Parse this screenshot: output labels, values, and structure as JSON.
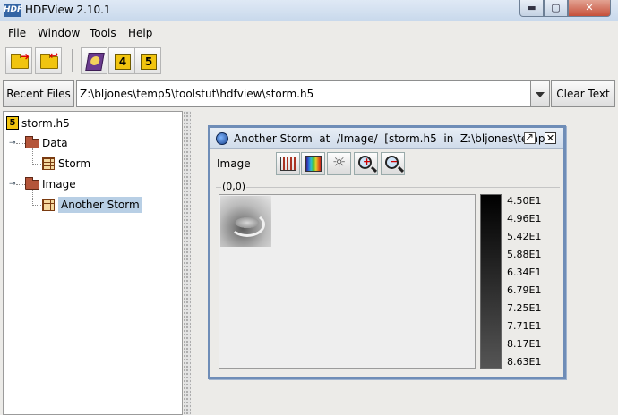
{
  "window": {
    "title": "HDFView 2.10.1",
    "app_icon_text": "HDF",
    "min_glyph": "▬",
    "max_glyph": "▢",
    "close_glyph": "✕"
  },
  "menu": [
    {
      "accel": "F",
      "rest": "ile"
    },
    {
      "accel": "W",
      "rest": "indow"
    },
    {
      "accel": "T",
      "rest": "ools"
    },
    {
      "accel": "H",
      "rest": "elp"
    }
  ],
  "toolbar": {
    "buttons": [
      "open-file-icon",
      "close-file-icon",
      "user-guide-icon",
      "hdf4-library-icon",
      "hdf5-library-icon"
    ],
    "hdf4_label": "4",
    "hdf5_label": "5"
  },
  "pathbar": {
    "recent_label": "Recent Files",
    "path": "Z:\\bljones\\temp5\\toolstut\\hdfview\\storm.h5",
    "clear_label": "Clear Text"
  },
  "tree": {
    "root": {
      "label": "storm.h5",
      "icon_text": "5"
    },
    "groups": [
      {
        "label": "Data",
        "children": [
          {
            "label": "Storm"
          }
        ]
      },
      {
        "label": "Image",
        "children": [
          {
            "label": "Another Storm",
            "selected": true
          }
        ]
      }
    ]
  },
  "image_view": {
    "title": "Another Storm  at  /Image/  [storm.h5  in  Z:\\bljones\\temp...",
    "toolbar_label": "Image",
    "tools": [
      "histogram-icon",
      "palette-icon",
      "brightness-icon",
      "zoom-in-icon",
      "zoom-out-icon"
    ],
    "zoom_in_mark": "+",
    "zoom_out_mark": "−",
    "sun_glyph": "☼",
    "close_glyph": "✕",
    "coordinate": "(0,0)",
    "legend_values": [
      "4.50E1",
      "4.96E1",
      "5.42E1",
      "5.88E1",
      "6.34E1",
      "6.79E1",
      "7.25E1",
      "7.71E1",
      "8.17E1",
      "8.63E1"
    ]
  },
  "colors": {
    "selection": "#b8cfe5",
    "frame_border": "#6f8db7",
    "close_red": "#c6503a"
  }
}
